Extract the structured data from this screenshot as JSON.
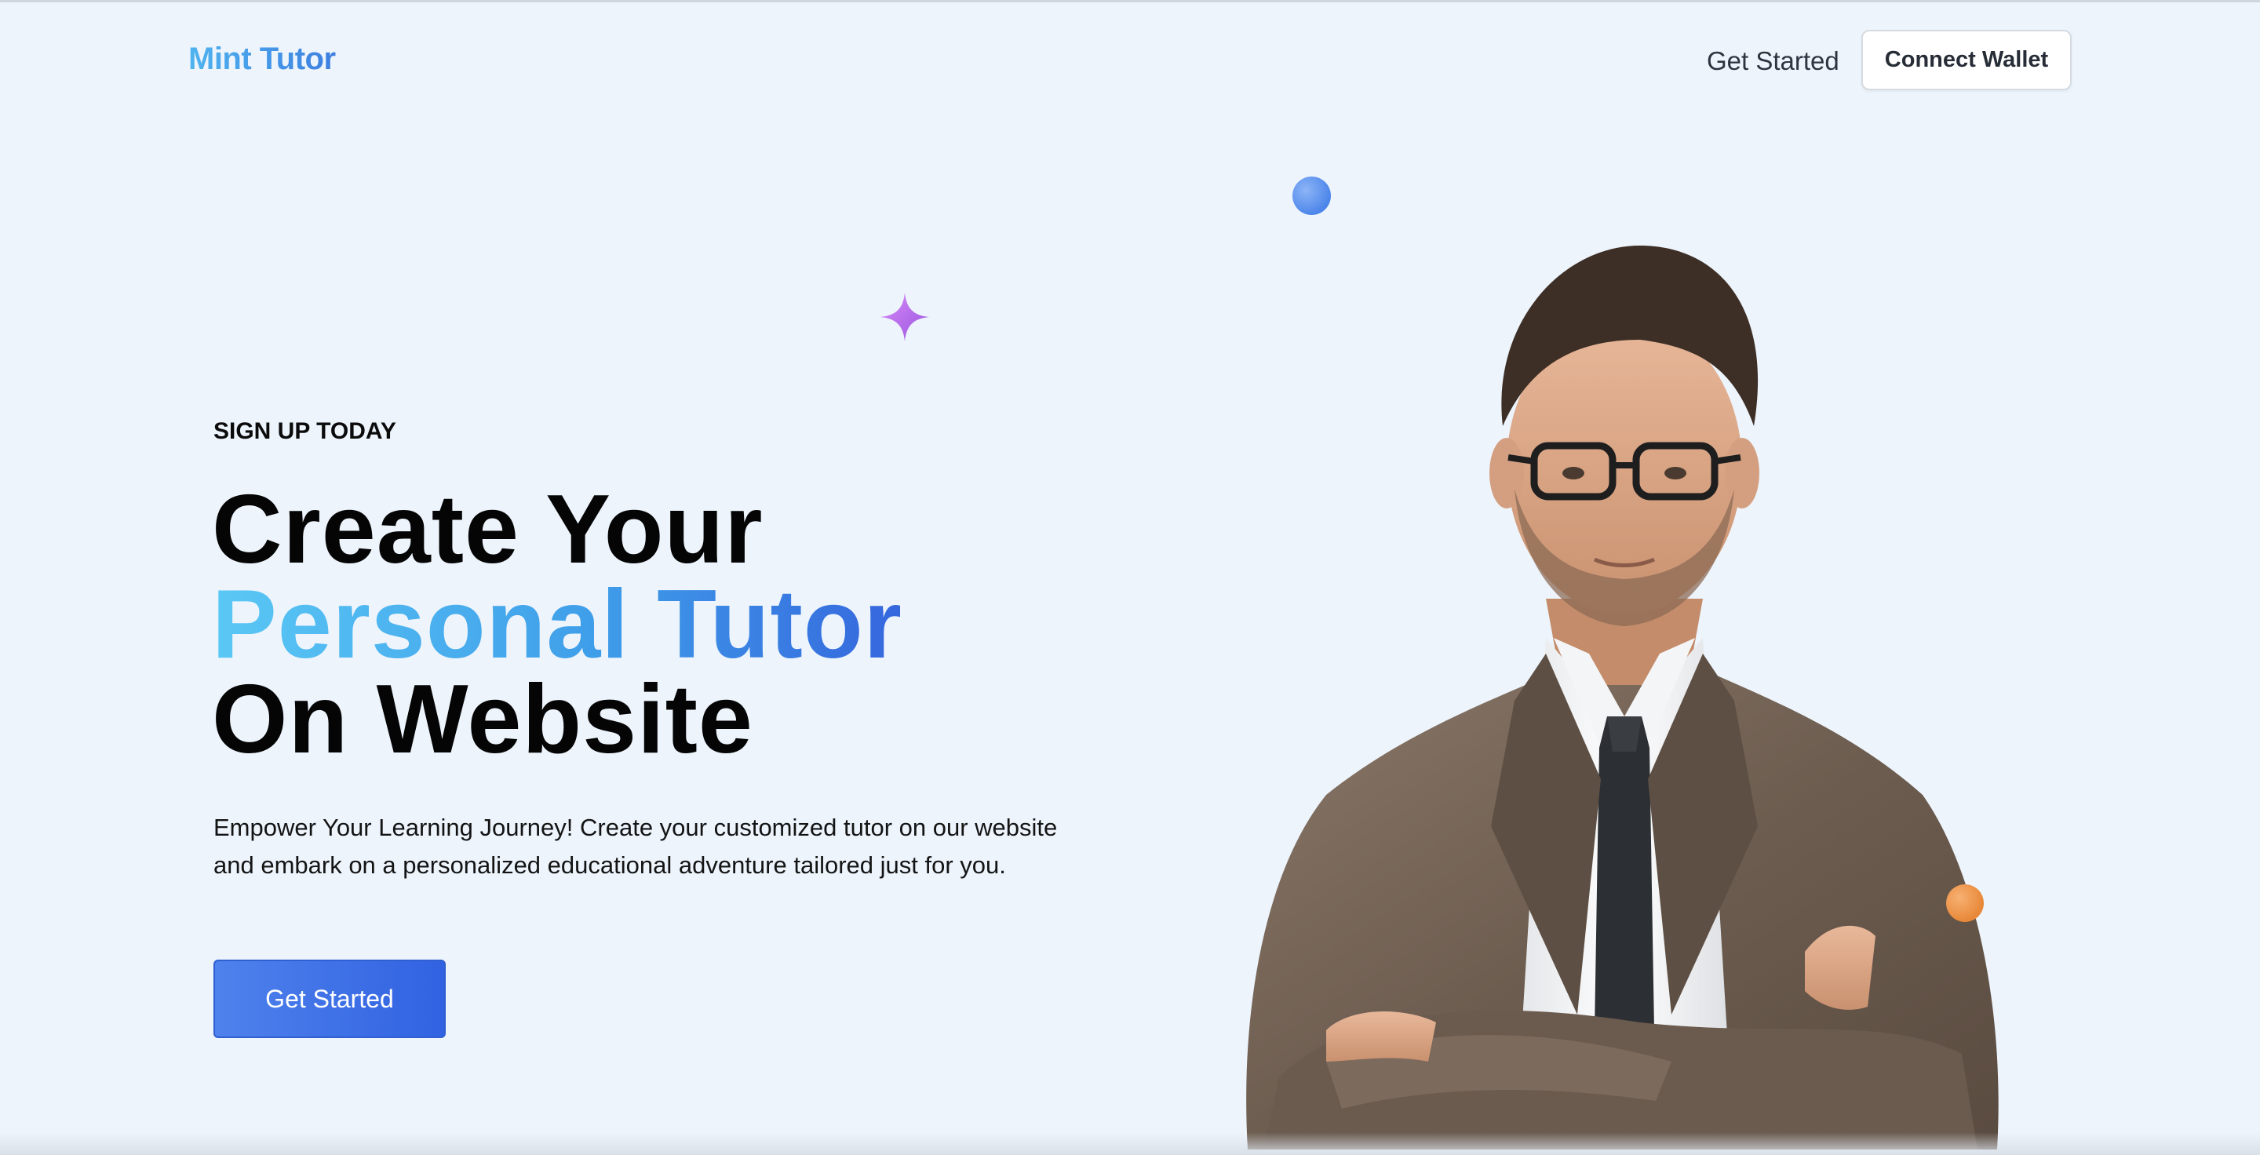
{
  "nav": {
    "logo": "Mint Tutor",
    "get_started": "Get Started",
    "connect_wallet": "Connect Wallet"
  },
  "hero": {
    "eyebrow": "SIGN UP TODAY",
    "headline_line1": "Create Your",
    "headline_line2": "Personal Tutor",
    "headline_line3": "On Website",
    "description": "Empower Your Learning Journey! Create your customized tutor on our website and embark on a personalized educational adventure tailored just for you.",
    "cta": "Get Started"
  },
  "decor": {
    "icons": [
      "sparkle-icon",
      "blue-dot",
      "orange-dot"
    ],
    "colors": {
      "accent_blue": "#3a6ee3",
      "gradient_start": "#5ac8f5",
      "sparkle_purple": "#b06be8",
      "dot_orange": "#e88838"
    }
  },
  "image": {
    "subject": "man in glasses, brown suit, arms crossed"
  }
}
